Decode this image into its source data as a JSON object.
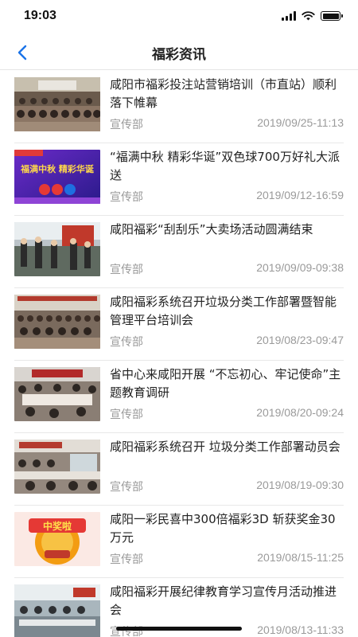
{
  "status_bar": {
    "time": "19:03"
  },
  "nav": {
    "title": "福彩资讯"
  },
  "news": [
    {
      "title": "咸阳市福彩投注站营销培训（市直站）顺利落下帷幕",
      "source": "宣传部",
      "date": "2019/09/25-11:13"
    },
    {
      "title": "“福满中秋 精彩华诞”双色球700万好礼大派送",
      "source": "宣传部",
      "date": "2019/09/12-16:59",
      "thumb_text": "福满中秋 精彩华诞"
    },
    {
      "title": "咸阳福彩“刮刮乐”大卖场活动圆满结束",
      "source": "宣传部",
      "date": "2019/09/09-09:38"
    },
    {
      "title": "咸阳福彩系统召开垃圾分类工作部署暨智能管理平台培训会",
      "source": "宣传部",
      "date": "2019/08/23-09:47"
    },
    {
      "title": "省中心来咸阳开展 “不忘初心、牢记使命”主题教育调研",
      "source": "宣传部",
      "date": "2019/08/20-09:24"
    },
    {
      "title": "咸阳福彩系统召开 垃圾分类工作部署动员会",
      "source": "宣传部",
      "date": "2019/08/19-09:30"
    },
    {
      "title": "咸阳一彩民喜中300倍福彩3D 斩获奖金30万元",
      "source": "宣传部",
      "date": "2019/08/15-11:25",
      "thumb_text": "中奖啦"
    },
    {
      "title": "咸阳福彩开展纪律教育学习宣传月活动推进会",
      "source": "宣传部",
      "date": "2019/08/13-11:33"
    }
  ]
}
